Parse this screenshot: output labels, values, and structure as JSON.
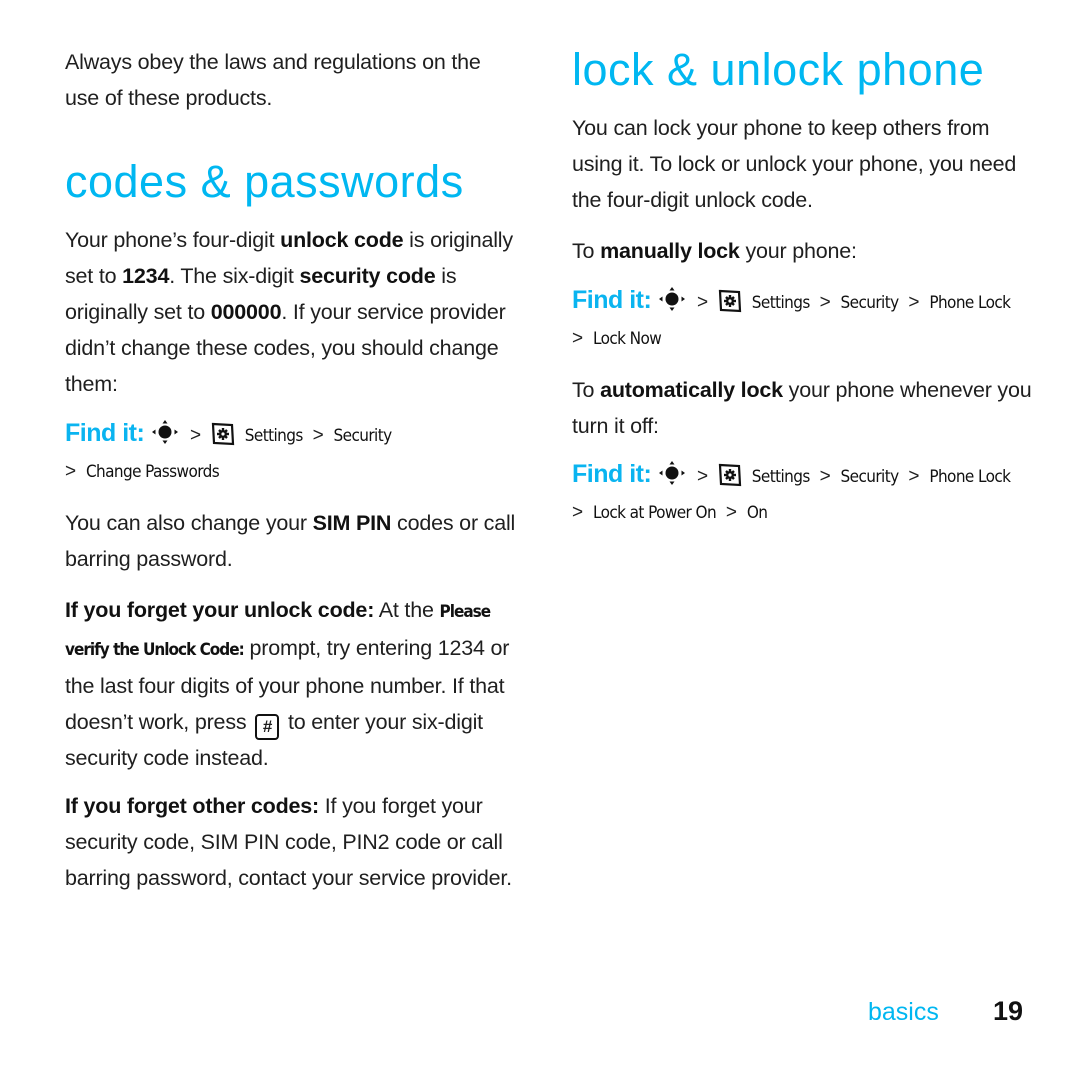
{
  "left": {
    "intro": "Always obey the laws and regulations on the use of these products.",
    "heading": "codes & passwords",
    "para1": {
      "t1": "Your phone’s four-digit ",
      "b1": "unlock code",
      "t2": " is originally set to ",
      "b2": "1234",
      "t3": ". The six-digit ",
      "b3": "security code",
      "t4": " is originally set to ",
      "b4": "000000",
      "t5": ". If your service provider didn’t change these codes, you should change them:"
    },
    "findit": {
      "label": "Find it:",
      "path": [
        "Settings",
        "Security",
        "Change Passwords"
      ]
    },
    "para2": {
      "t1": "You can also change your ",
      "b1": "SIM PIN",
      "t2": " codes or call barring password."
    },
    "para3": {
      "b1": "If you forget your unlock code:",
      "t1": " At the ",
      "prompt": "Please verify the Unlock Code:",
      "t2": " prompt, try entering 1234 or the last four digits of your phone number. If that doesn’t work, press ",
      "key": "#",
      "t3": " to enter your six-digit security code instead."
    },
    "para4": {
      "b1": "If you forget other codes:",
      "t1": " If you forget your security code, SIM PIN code, PIN2 code or call barring password, contact your service provider."
    }
  },
  "right": {
    "heading": "lock & unlock phone",
    "para1": "You can lock your phone to keep others from using it. To lock or unlock your phone, you need the four-digit unlock code.",
    "para2": {
      "t1": "To ",
      "b1": "manually lock",
      "t2": " your phone:"
    },
    "findit1": {
      "label": "Find it:",
      "path": [
        "Settings",
        "Security",
        "Phone Lock",
        "Lock Now"
      ]
    },
    "para3": {
      "t1": "To ",
      "b1": "automatically lock",
      "t2": " your phone whenever you turn it off:"
    },
    "findit2": {
      "label": "Find it:",
      "path": [
        "Settings",
        "Security",
        "Phone Lock",
        "Lock at Power On",
        "On"
      ]
    }
  },
  "footer": {
    "section": "basics",
    "page": "19"
  },
  "colors": {
    "accent": "#00b7f1",
    "text": "#1f1f1f"
  },
  "separator": ">"
}
